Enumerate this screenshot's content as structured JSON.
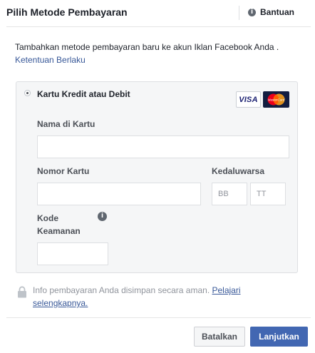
{
  "dialog": {
    "title": "Pilih Metode Pembayaran",
    "help_label": "Bantuan"
  },
  "intro": {
    "text": "Tambahkan metode pembayaran baru ke akun Iklan Facebook Anda .",
    "terms_link": "Ketentuan Berlaku"
  },
  "payment_option": {
    "label": "Kartu Kredit atau Debit",
    "selected": true,
    "brands": [
      "VISA",
      "MasterCard"
    ]
  },
  "form": {
    "name_label": "Nama di Kartu",
    "name_value": "",
    "card_number_label": "Nomor Kartu",
    "card_number_value": "",
    "expiry_label": "Kedaluwarsa",
    "expiry_month_placeholder": "BB",
    "expiry_year_placeholder": "TT",
    "security_code_label_line1": "Kode",
    "security_code_label_line2": "Keamanan",
    "security_code_value": ""
  },
  "security_note": {
    "text": "Info pembayaran Anda disimpan secara aman.",
    "link": "Pelajari selengkapnya."
  },
  "footer": {
    "cancel_label": "Batalkan",
    "continue_label": "Lanjutkan"
  },
  "colors": {
    "primary_button": "#4267b2",
    "link": "#385898",
    "panel_bg": "#f5f6f7"
  },
  "icons": [
    "info-icon",
    "lock-icon",
    "radio-selected-icon",
    "visa-logo",
    "mastercard-logo"
  ]
}
